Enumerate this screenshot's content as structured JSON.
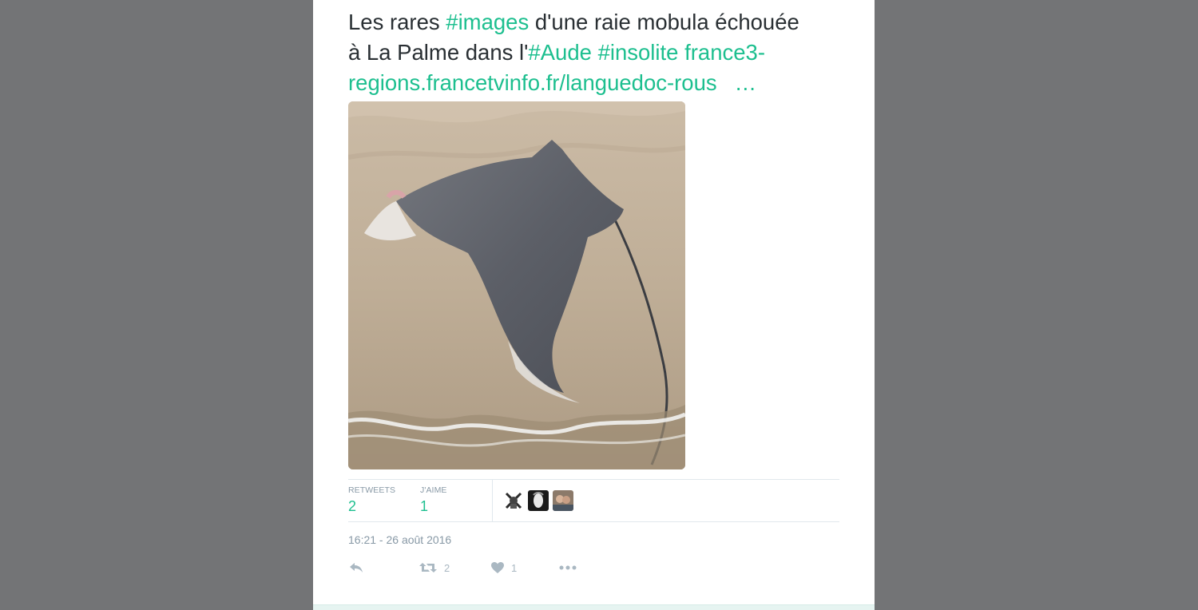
{
  "tweet": {
    "text_lines": [
      [
        {
          "t": "Les rares ",
          "link": false
        },
        {
          "t": "#images",
          "link": true
        },
        {
          "t": " d'une raie mobula échouée",
          "link": false
        }
      ],
      [
        {
          "t": "à La Palme dans l'",
          "link": false
        },
        {
          "t": "#Aude",
          "link": true
        },
        {
          "t": " ",
          "link": false
        },
        {
          "t": "#insolite",
          "link": true
        },
        {
          "t": " ",
          "link": false
        },
        {
          "t": "france3-",
          "link": true
        }
      ],
      [
        {
          "t": "regions.francetvinfo.fr/languedoc-rous",
          "link": true
        }
      ]
    ],
    "ellipsis": "…",
    "image_subject": "stranded mobula ray on sandy beach"
  },
  "stats": {
    "retweets_label": "RETWEETS",
    "retweets_value": "2",
    "likes_label": "J'AIME",
    "likes_value": "1",
    "avatars": [
      "avatar-1",
      "avatar-2",
      "avatar-3"
    ]
  },
  "timestamp": "16:21 - 26 août 2016",
  "actions": {
    "reply_icon": "reply-icon",
    "retweet_icon": "retweet-icon",
    "retweet_count": "2",
    "like_icon": "heart-icon",
    "like_count": "1",
    "more_icon": "more-icon"
  },
  "colors": {
    "page_background": "#737476",
    "card": "#ffffff",
    "accent": "#1dbf8f",
    "text": "#292f33",
    "muted": "#8899a6",
    "icon": "#aab8c2"
  }
}
